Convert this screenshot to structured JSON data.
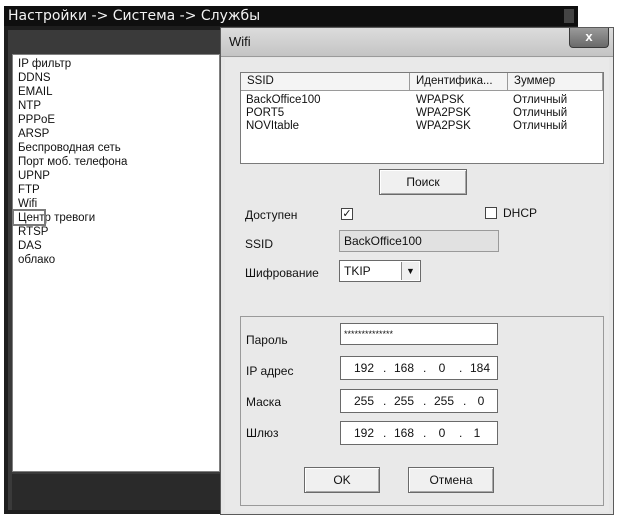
{
  "main_window": {
    "title": "Настройки -> Система -> Службы",
    "services": [
      "IP фильтр",
      "DDNS",
      "EMAIL",
      "NTP",
      "PPPoE",
      "ARSP",
      "Беспроводная сеть",
      "Порт моб. телефона",
      "UPNP",
      "FTP",
      "Wifi",
      "Центр тревоги",
      "RTSP",
      "DAS",
      "облако"
    ],
    "selected_service": "Wifi"
  },
  "dialog": {
    "title": "Wifi",
    "close_glyph": "x",
    "network_list": {
      "columns": [
        "SSID",
        "Идентифика...",
        "Зуммер"
      ],
      "rows": [
        [
          "BackOffice100",
          "WPAPSK",
          "Отличный"
        ],
        [
          "PORT5",
          "WPA2PSK",
          "Отличный"
        ],
        [
          "NOVItable",
          "WPA2PSK",
          "Отличный"
        ]
      ]
    },
    "search_button": "Поиск",
    "enabled_label": "Доступен",
    "enabled_checked": true,
    "dhcp_label": "DHCP",
    "dhcp_checked": false,
    "ssid_label": "SSID",
    "ssid_value": "BackOffice100",
    "encryption_label": "Шифрование",
    "encryption_value": "TKIP",
    "password_label": "Пароль",
    "password_value": "**************",
    "ip_label": "IP адрес",
    "ip_value": [
      "192",
      "168",
      "0",
      "184"
    ],
    "mask_label": "Маска",
    "mask_value": [
      "255",
      "255",
      "255",
      "0"
    ],
    "gateway_label": "Шлюз",
    "gateway_value": [
      "192",
      "168",
      "0",
      "1"
    ],
    "ok_button": "OK",
    "cancel_button": "Отмена"
  }
}
